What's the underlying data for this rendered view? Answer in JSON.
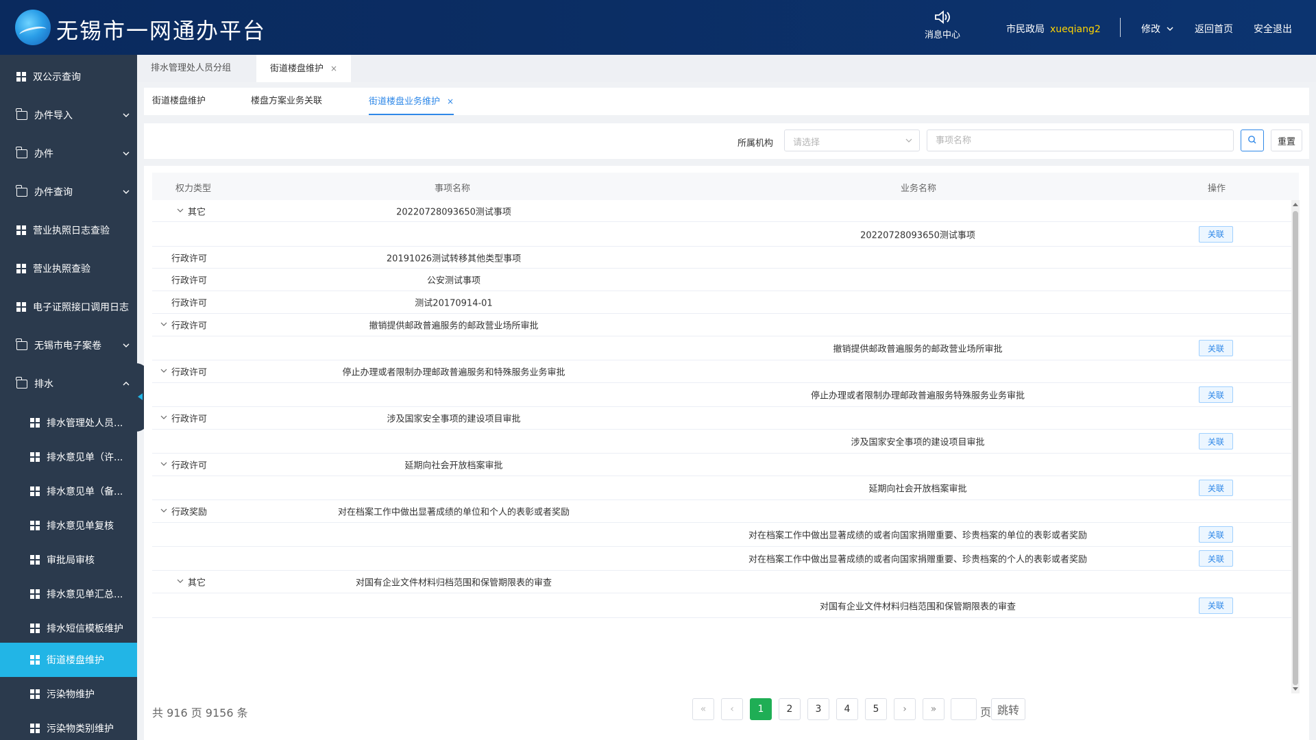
{
  "header": {
    "app_title": "无锡市一网通办平台",
    "message_center": "消息中心",
    "org": "市民政局",
    "username": "xueqiang2",
    "modify": "修改",
    "home": "返回首页",
    "logout": "安全退出"
  },
  "sidebar": {
    "items": [
      {
        "label": "双公示查询",
        "icon": "grid-icon"
      },
      {
        "label": "办件导入",
        "icon": "folder-icon",
        "expand": "down"
      },
      {
        "label": "办件",
        "icon": "folder-icon",
        "expand": "down"
      },
      {
        "label": "办件查询",
        "icon": "folder-icon",
        "expand": "down"
      },
      {
        "label": "营业执照日志查验",
        "icon": "grid-icon"
      },
      {
        "label": "营业执照查验",
        "icon": "grid-icon"
      },
      {
        "label": "电子证照接口调用日志",
        "icon": "grid-icon"
      },
      {
        "label": "无锡市电子案卷",
        "icon": "folder-icon",
        "expand": "down"
      },
      {
        "label": "排水",
        "icon": "folder-icon",
        "expand": "up"
      }
    ],
    "sub_items": [
      {
        "label": "排水管理处人员..."
      },
      {
        "label": "排水意见单（许..."
      },
      {
        "label": "排水意见单（备..."
      },
      {
        "label": "排水意见单复核"
      },
      {
        "label": "审批局审核"
      },
      {
        "label": "排水意见单汇总..."
      },
      {
        "label": "排水短信模板维护"
      },
      {
        "label": "街道楼盘维护",
        "active": true
      },
      {
        "label": "污染物维护"
      },
      {
        "label": "污染物类别维护"
      }
    ]
  },
  "tabs_top": [
    {
      "label": "排水管理处人员分组"
    },
    {
      "label": "街道楼盘维护",
      "close": "×",
      "active": true
    }
  ],
  "tabs_sub": [
    {
      "label": "街道楼盘维护"
    },
    {
      "label": "楼盘方案业务关联"
    },
    {
      "label": "街道楼盘业务维护",
      "close": "×",
      "active": true
    }
  ],
  "filter": {
    "org_label": "所属机构",
    "org_placeholder": "请选择",
    "name_placeholder": "事项名称",
    "reset": "重置"
  },
  "table": {
    "headers": [
      "权力类型",
      "事项名称",
      "业务名称",
      "操作"
    ],
    "action_label": "关联",
    "rows": [
      {
        "type": "其它",
        "item": "20220728093650测试事项",
        "business": "",
        "caret": "child",
        "action": false
      },
      {
        "type": "",
        "item": "",
        "business": "20220728093650测试事项",
        "action": true
      },
      {
        "type": "行政许可",
        "item": "20191026测试转移其他类型事项",
        "business": "",
        "action": false
      },
      {
        "type": "行政许可",
        "item": "公安测试事项",
        "business": "",
        "action": false
      },
      {
        "type": "行政许可",
        "item": "测试20170914-01",
        "business": "",
        "action": false
      },
      {
        "type": "行政许可",
        "item": "撤销提供邮政普遍服务的邮政营业场所审批",
        "business": "",
        "caret": "top",
        "action": false
      },
      {
        "type": "",
        "item": "",
        "business": "撤销提供邮政普遍服务的邮政营业场所审批",
        "action": true
      },
      {
        "type": "行政许可",
        "item": "停止办理或者限制办理邮政普遍服务和特殊服务业务审批",
        "business": "",
        "caret": "top",
        "action": false
      },
      {
        "type": "",
        "item": "",
        "business": "停止办理或者限制办理邮政普遍服务特殊服务业务审批",
        "action": true
      },
      {
        "type": "行政许可",
        "item": "涉及国家安全事项的建设项目审批",
        "business": "",
        "caret": "top",
        "action": false
      },
      {
        "type": "",
        "item": "",
        "business": "涉及国家安全事项的建设项目审批",
        "action": true
      },
      {
        "type": "行政许可",
        "item": "延期向社会开放档案审批",
        "business": "",
        "caret": "top",
        "action": false
      },
      {
        "type": "",
        "item": "",
        "business": "延期向社会开放档案审批",
        "action": true
      },
      {
        "type": "行政奖励",
        "item": "对在档案工作中做出显著成绩的单位和个人的表彰或者奖励",
        "business": "",
        "caret": "top",
        "action": false
      },
      {
        "type": "",
        "item": "",
        "business": "对在档案工作中做出显著成绩的或者向国家捐赠重要、珍贵档案的单位的表彰或者奖励",
        "action": true
      },
      {
        "type": "",
        "item": "",
        "business": "对在档案工作中做出显著成绩的或者向国家捐赠重要、珍贵档案的个人的表彰或者奖励",
        "action": true
      },
      {
        "type": "其它",
        "item": "对国有企业文件材料归档范围和保管期限表的审查",
        "business": "",
        "caret": "child",
        "action": false
      },
      {
        "type": "",
        "item": "",
        "business": "对国有企业文件材料归档范围和保管期限表的审查",
        "action": true
      }
    ]
  },
  "pagination": {
    "total": "共 916 页 9156 条",
    "first": "«",
    "prev": "‹",
    "pages": [
      "1",
      "2",
      "3",
      "4",
      "5"
    ],
    "current": "1",
    "next": "›",
    "last": "»",
    "page_unit": "页",
    "jump": "跳转"
  },
  "colors": {
    "header_bg": "#0b2d63",
    "sidebar_bg": "#2b3a4d",
    "active_menu": "#22b5e6",
    "accent": "#2f88e8",
    "username": "#ffd400",
    "page_active": "#1fae55"
  }
}
